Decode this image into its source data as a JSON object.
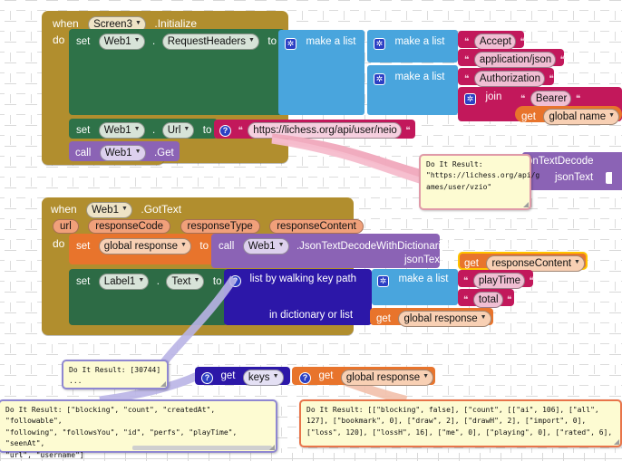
{
  "workspace": {
    "app": "MIT App Inventor Blocks Editor",
    "background": "#ffffff",
    "grid_color": "#dcdcdc"
  },
  "blocks": {
    "event1": {
      "when": "when",
      "component": "Screen3",
      "event": ".Initialize",
      "do": "do",
      "color": "#b18e2e"
    },
    "set_requestheaders": {
      "set": "set",
      "component": "Web1",
      "dot": ".",
      "property": "RequestHeaders",
      "to": "to",
      "color": "#2e7248"
    },
    "make_a_list_outer": {
      "label": "make a list",
      "color": "#49a5dd"
    },
    "make_a_list_inner1": {
      "label": "make a list",
      "color": "#49a5dd"
    },
    "make_a_list_inner2": {
      "label": "make a list",
      "color": "#49a5dd"
    },
    "text_accept": {
      "value": "Accept",
      "color": "#c2185b"
    },
    "text_application_json": {
      "value": "application/json",
      "color": "#c2185b"
    },
    "text_authorization": {
      "value": "Authorization",
      "color": "#c2185b"
    },
    "join_block": {
      "label": "join",
      "color": "#c2185b"
    },
    "text_bearer": {
      "value": "Bearer ",
      "color": "#c2185b"
    },
    "get_global_name": {
      "get": "get",
      "variable": "global name",
      "color": "#e8742c"
    },
    "set_url": {
      "set": "set",
      "component": "Web1",
      "dot": ".",
      "property": "Url",
      "to": "to",
      "color": "#2e7248"
    },
    "text_url": {
      "value": "https://lichess.org/api/user/neio",
      "color": "#c2185b"
    },
    "call_get": {
      "call": "call",
      "component": "Web1",
      "method": ".Get",
      "color": "#8b63b5"
    },
    "hidden_decode": {
      "line1": "onTextDecode",
      "line2": "jsonText",
      "color": "#8b63b5"
    },
    "event2": {
      "when": "when",
      "component": "Web1",
      "event": ".GotText",
      "do": "do",
      "params": [
        "url",
        "responseCode",
        "responseType",
        "responseContent"
      ],
      "color": "#b18e2e"
    },
    "set_global_response": {
      "set": "set",
      "variable": "global response",
      "to": "to",
      "color": "#e8742c"
    },
    "call_jsondecode": {
      "call": "call",
      "component": "Web1",
      "method": ".JsonTextDecodeWithDictionaries",
      "socket": "jsonText",
      "color": "#8b63b5"
    },
    "get_responsecontent": {
      "get": "get",
      "variable": "responseContent",
      "color": "#e8742c",
      "selected": true
    },
    "set_label1_text": {
      "set": "set",
      "component": "Label1",
      "dot": ".",
      "property": "Text",
      "to": "to",
      "color": "#2e7248"
    },
    "walk_key_path": {
      "label": "list by walking key path",
      "socket2": "in dictionary or list",
      "color": "#2c17a8"
    },
    "make_a_list_keys": {
      "label": "make a list",
      "color": "#49a5dd"
    },
    "text_playtime": {
      "value": "playTime",
      "color": "#c2185b"
    },
    "text_total": {
      "value": "total",
      "color": "#c2185b"
    },
    "get_global_response_1": {
      "get": "get",
      "variable": "global response",
      "color": "#e8742c"
    },
    "get_keys": {
      "get": "get",
      "variable": "keys",
      "color": "#2c17a8"
    },
    "get_global_response_2": {
      "get": "get",
      "variable": "global response",
      "color": "#e8742c"
    }
  },
  "results": {
    "url_result": {
      "title": "Do It Result:",
      "lines": [
        "\"https://lichess.org/api/g",
        "ames/user/vzio\""
      ]
    },
    "playtime_result": {
      "title": "Do It Result: [30744]",
      "lines": [
        "..."
      ]
    },
    "keys_result": {
      "lines": [
        "Do It Result: [\"blocking\", \"count\", \"createdAt\", \"followable\",",
        "\"following\", \"followsYou\", \"id\", \"perfs\", \"playTime\", \"seenAt\",",
        "\"url\", \"username\"]"
      ]
    },
    "response_result": {
      "lines": [
        "Do It Result: [[\"blocking\", false], [\"count\", [[\"ai\", 106], [\"all\",",
        "127], [\"bookmark\", 0], [\"draw\", 2], [\"drawH\", 2], [\"import\", 0],",
        "[\"loss\", 120], [\"lossH\", 16], [\"me\", 0], [\"playing\", 0], [\"rated\", 6],"
      ]
    }
  }
}
